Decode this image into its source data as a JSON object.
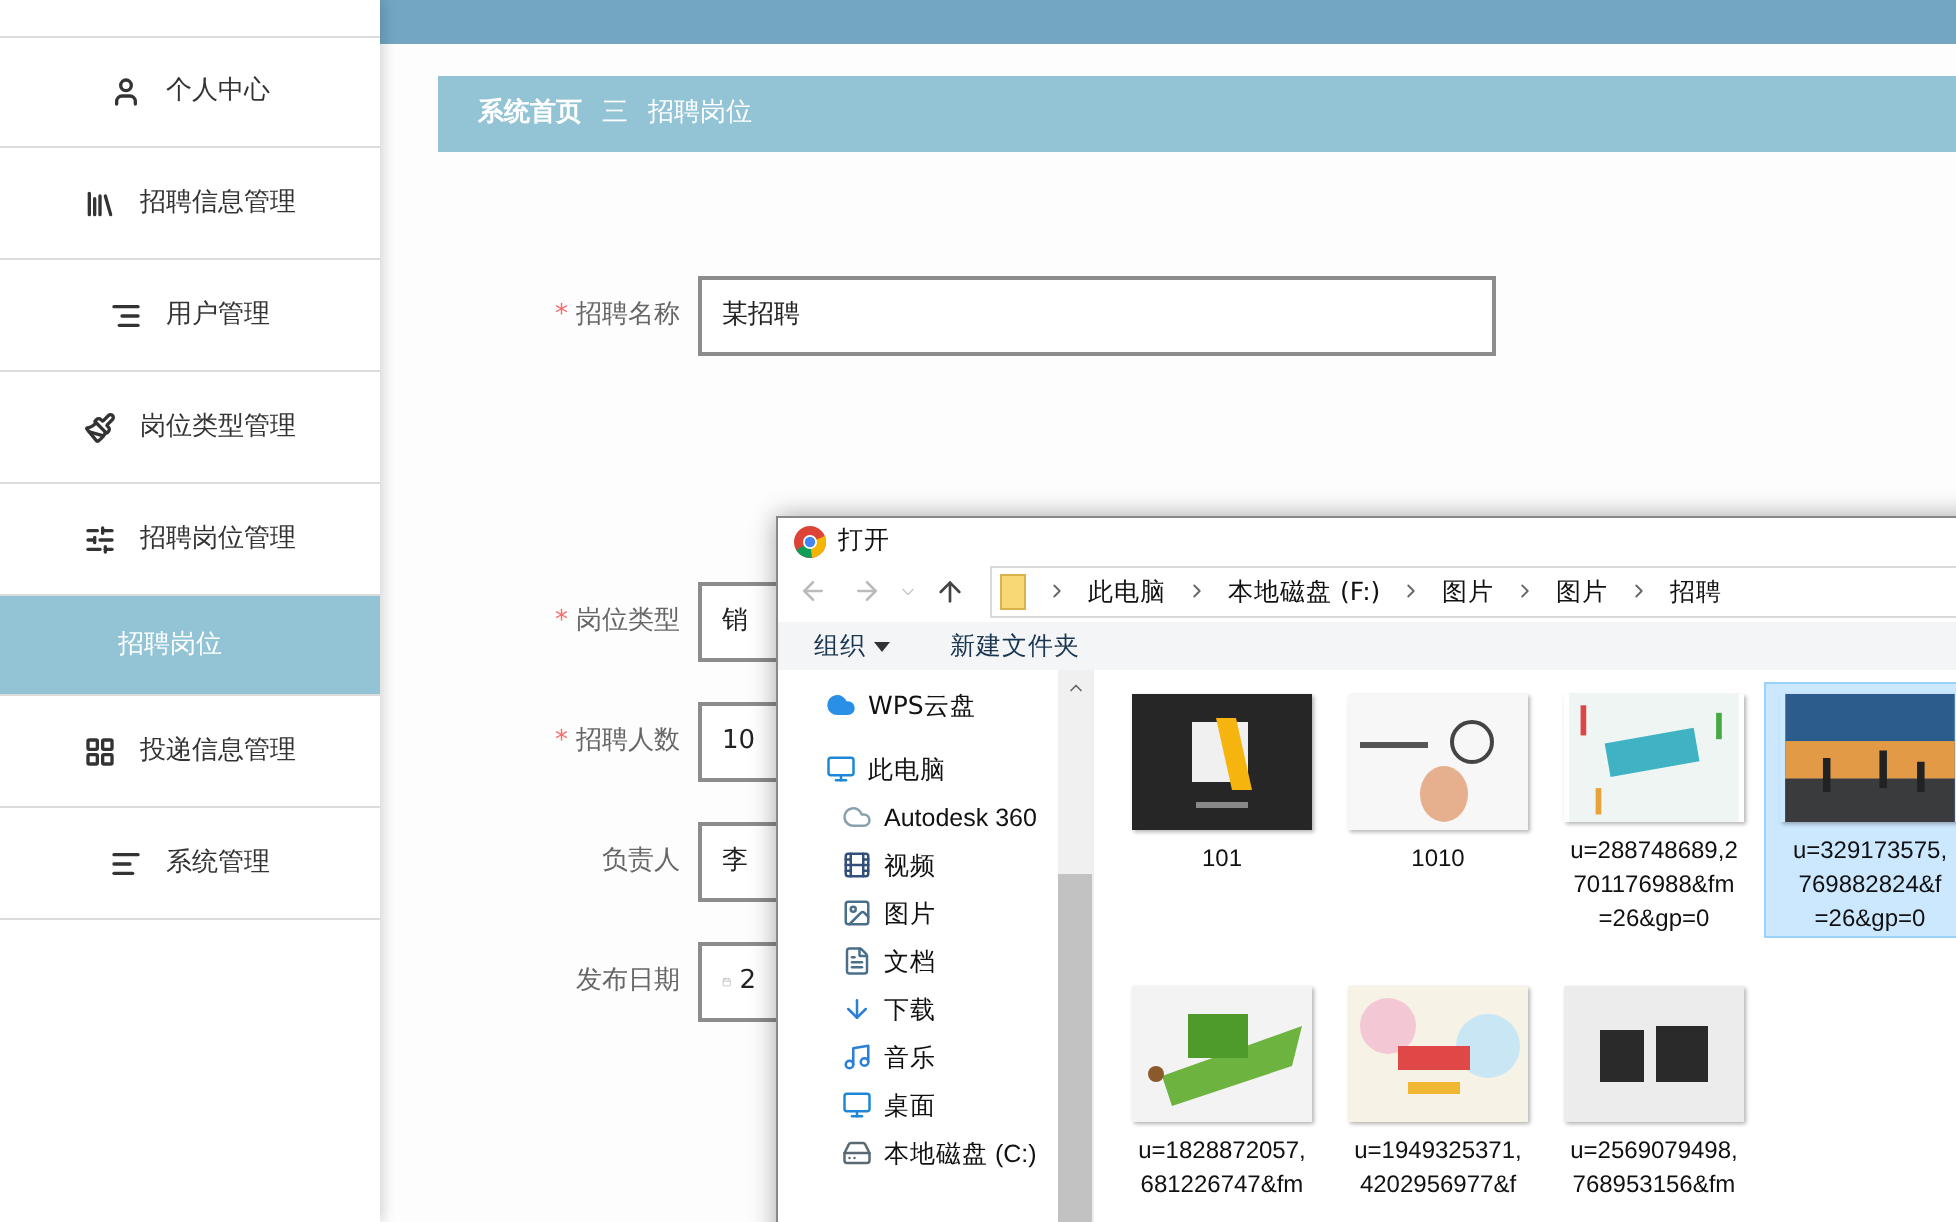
{
  "sidebar": {
    "items": [
      {
        "label": "个人中心",
        "selected": false
      },
      {
        "label": "招聘信息管理",
        "selected": false
      },
      {
        "label": "用户管理",
        "selected": false
      },
      {
        "label": "岗位类型管理",
        "selected": false
      },
      {
        "label": "招聘岗位管理",
        "selected": false
      },
      {
        "label": "招聘岗位",
        "selected": true
      },
      {
        "label": "投递信息管理",
        "selected": false
      },
      {
        "label": "系统管理",
        "selected": false
      }
    ]
  },
  "breadcrumb": {
    "home": "系统首页",
    "separator": "三",
    "current": "招聘岗位"
  },
  "form": {
    "required_mark": "*",
    "fields": [
      {
        "label": "招聘名称",
        "required": true,
        "kind": "text",
        "value": "某招聘"
      },
      {
        "label": "岗位类型",
        "required": true,
        "kind": "text",
        "value": "销"
      },
      {
        "label": "招聘人数",
        "required": true,
        "kind": "text",
        "value": "10"
      },
      {
        "label": "负责人",
        "required": false,
        "kind": "text",
        "value": "李"
      },
      {
        "label": "发布日期",
        "required": false,
        "kind": "date",
        "value": "2"
      }
    ]
  },
  "dialog": {
    "title": "打开",
    "path": [
      "此电脑",
      "本地磁盘 (F:)",
      "图片",
      "图片",
      "招聘"
    ],
    "toolbar": [
      {
        "label": "组织",
        "kind": "menu"
      },
      {
        "label": "新建文件夹",
        "kind": "button"
      }
    ],
    "nav": [
      {
        "label": "WPS云盘"
      },
      {
        "label": "此电脑",
        "children": [
          {
            "label": "Autodesk 360"
          },
          {
            "label": "视频"
          },
          {
            "label": "图片"
          },
          {
            "label": "文档"
          },
          {
            "label": "下载"
          },
          {
            "label": "音乐"
          },
          {
            "label": "桌面"
          },
          {
            "label": "本地磁盘 (C:)"
          }
        ]
      }
    ],
    "files": [
      {
        "lines": [
          "101"
        ],
        "selected": false,
        "kind": "dark"
      },
      {
        "lines": [
          "1010"
        ],
        "selected": false,
        "kind": "white"
      },
      {
        "lines": [
          "u=288748689,2",
          "701176988&fm",
          "=26&gp=0"
        ],
        "selected": false,
        "kind": "pastel"
      },
      {
        "lines": [
          "u=329173575,",
          "769882824&f",
          "=26&gp=0"
        ],
        "selected": true,
        "kind": "sunset"
      },
      {
        "lines": [
          "u=1828872057,",
          "681226747&fm"
        ],
        "selected": false,
        "kind": "green"
      },
      {
        "lines": [
          "u=1949325371,",
          "4202956977&f"
        ],
        "selected": false,
        "kind": "rainbow"
      },
      {
        "lines": [
          "u=2569079498,",
          "768953156&fm"
        ],
        "selected": false,
        "kind": "gray"
      }
    ]
  }
}
